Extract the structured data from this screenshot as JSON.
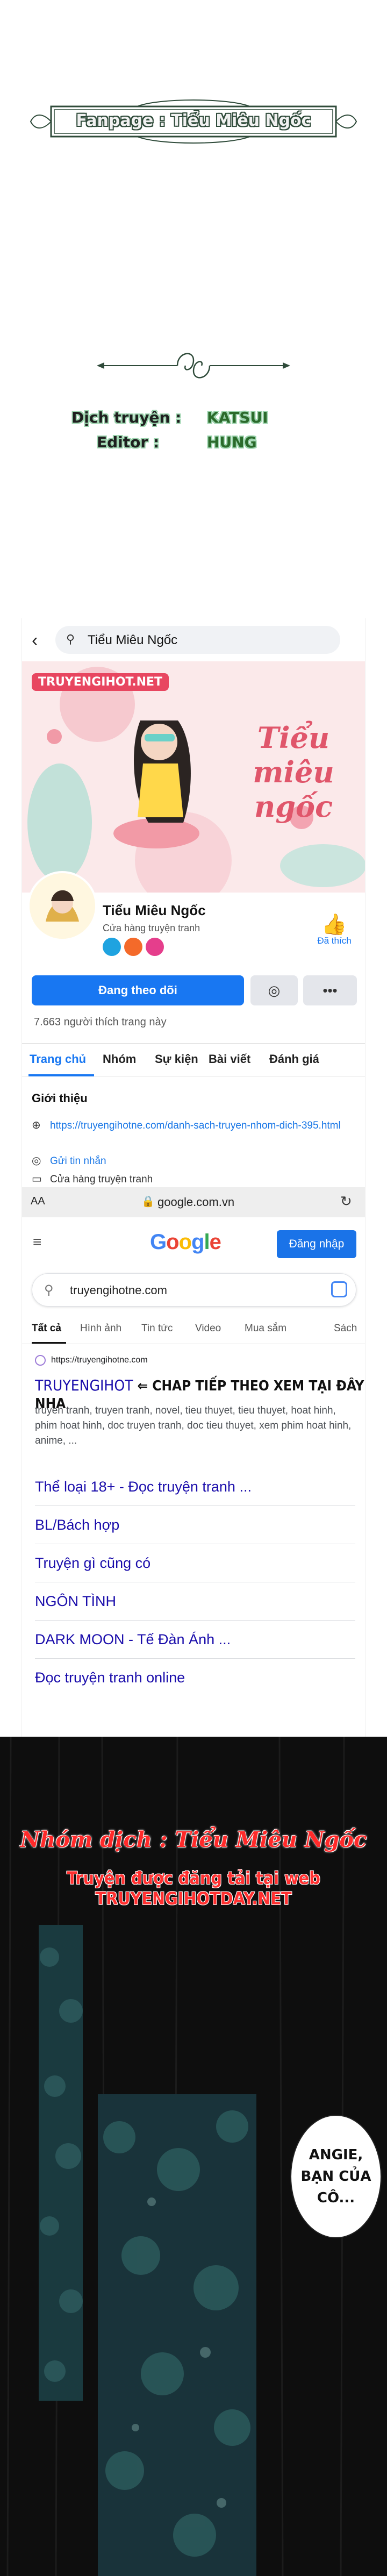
{
  "intro": {
    "fanpage_text": "Fanpage : Tiểu Miêu Ngốc",
    "translator_label": "Dịch truyện :",
    "translator_name": "KATSUI",
    "editor_label": "Editor :",
    "editor_name": "HUNG"
  },
  "facebook": {
    "back_icon": "back-arrow-icon",
    "search_value": "Tiểu Miêu Ngốc",
    "cover": {
      "logo_text": "TRUYENGIHOT.NET",
      "title": "Tiểu miêu ngốc"
    },
    "page_name": "Tiểu Miêu Ngốc",
    "page_category": "Cửa hàng truyện tranh",
    "liked_label": "Đã thích",
    "follow_button": "Đang theo dõi",
    "likes_count": "7.663 người thích trang này",
    "tabs": [
      "Trang chủ",
      "Nhóm",
      "Sự kiện",
      "Bài viết",
      "Đánh giá"
    ],
    "about_heading": "Giới thiệu",
    "about": {
      "website": "https://truyengihotne.com/danh-sach-truyen-nhom-dich-395.html",
      "message": "Gửi tin nhắn",
      "category": "Cửa hàng truyện tranh"
    },
    "colors": {
      "accent": "#1877f2",
      "brand_pink": "#e84660"
    }
  },
  "browser": {
    "aa_label": "AA",
    "domain": "google.com.vn"
  },
  "google": {
    "logo": "Google",
    "signin_button": "Đăng nhập",
    "query": "truyengihotne.com",
    "tabs": [
      "Tất cả",
      "Hình ảnh",
      "Tin tức",
      "Video",
      "Mua sắm",
      "Sách"
    ],
    "result": {
      "site": "https://truyengihotne.com",
      "title_main": "TRUYENGIHOT",
      "title_cta": "⇐ CHAP TIẾP THEO XEM TẠI ĐÂY NHA",
      "snippet": "truyen tranh, truyen tranh, novel, tieu thuyet, tieu thuyet, hoat hinh, phim hoat hinh, doc truyen tranh, doc tieu thuyet, xem phim hoat hinh, anime, ...",
      "sitelinks": [
        "Thể loại 18+ - Đọc truyện tranh ...",
        "BL/Bách hợp",
        "Truyện gì cũng có",
        "NGÔN TÌNH",
        "DARK MOON - Tế Đàn Ánh ...",
        "Đọc truyện tranh online"
      ]
    }
  },
  "scene": {
    "translator_credit": "Nhóm dịch : Tiểu Miêu Ngốc",
    "publish_note": "Truyện được đăng tải tại web TRUYENGIHOTDAY.NET",
    "speech": "ANGIE,\nBẠN CỦA\nCÔ..."
  }
}
